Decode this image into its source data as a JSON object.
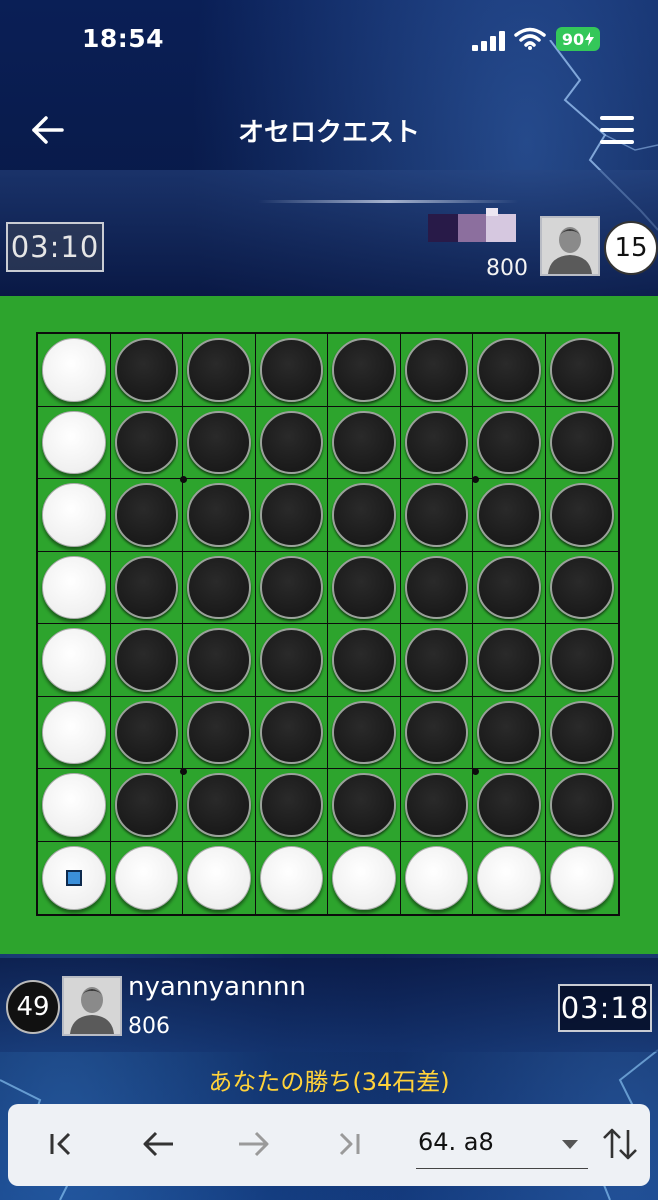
{
  "status_bar": {
    "time": "18:54",
    "battery": "90",
    "icons": [
      "signal-icon",
      "wifi-icon",
      "battery-icon"
    ]
  },
  "nav": {
    "title": "オセロクエスト",
    "back_icon": "arrow-left-icon",
    "menu_icon": "hamburger-menu-icon"
  },
  "opponent": {
    "timer": "03:10",
    "rating": "800",
    "disc_count": "15",
    "name": "",
    "avatar_icon": "user-avatar-icon"
  },
  "player": {
    "name": "nyannyannnn",
    "rating": "806",
    "disc_count": "49",
    "timer": "03:18",
    "avatar_icon": "user-avatar-icon"
  },
  "result_text": "あなたの勝ち(34石差)",
  "board": {
    "rows": [
      "WBBBBBBB",
      "WBBBBBBB",
      "WBBBBBBB",
      "WBBBBBBB",
      "WBBBBBBB",
      "WBBBBBBB",
      "WBBBBBBB",
      "WWWWWWWW"
    ],
    "last_move": "a8",
    "colors": {
      "board": "#2da42d",
      "line": "#0c0c0c",
      "marker": "#3b8fd9"
    }
  },
  "toolbar": {
    "buttons": [
      {
        "name": "first-move-button",
        "icon": "skip-to-start-icon"
      },
      {
        "name": "prev-move-button",
        "icon": "arrow-left-icon"
      },
      {
        "name": "next-move-button",
        "icon": "arrow-right-icon"
      },
      {
        "name": "last-move-button",
        "icon": "skip-to-end-icon"
      }
    ],
    "move_value": "64. a8",
    "swap_icon": "swap-vertical-icon"
  },
  "colors": {
    "accent_result": "#ffd23a",
    "battery": "#34c759",
    "background": "#06143a"
  }
}
